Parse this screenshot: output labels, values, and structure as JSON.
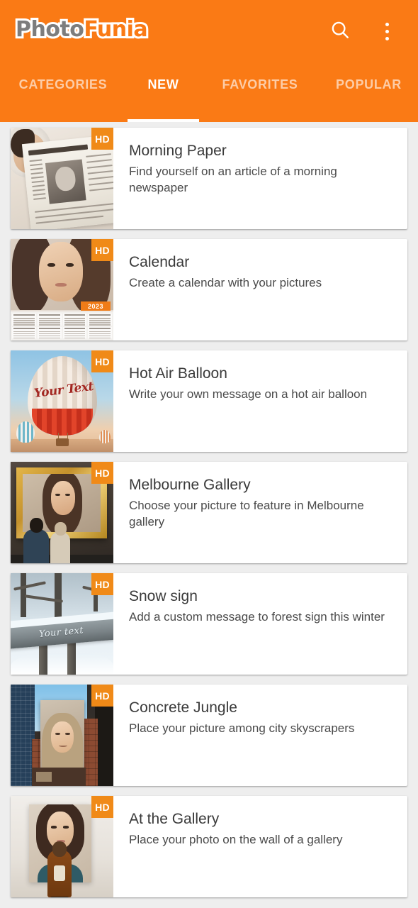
{
  "app": {
    "logo_prefix": "Photo",
    "logo_suffix": "Funia",
    "accent_color": "#FA7A15",
    "badge_color": "#F08A18"
  },
  "header": {
    "search_icon": "search-icon",
    "overflow_icon": "more-vertical-icon"
  },
  "tabs": [
    {
      "label": "CATEGORIES",
      "active": false
    },
    {
      "label": "NEW",
      "active": true
    },
    {
      "label": "FAVORITES",
      "active": false
    },
    {
      "label": "POPULAR",
      "active": false
    }
  ],
  "badge": {
    "hd_label": "HD"
  },
  "thumb_text": {
    "balloon": "Your Text",
    "snow": "Your text",
    "calendar_year": "2023"
  },
  "effects": [
    {
      "title": "Morning Paper",
      "description": "Find yourself on an article of a morning newspaper",
      "hd": "HD"
    },
    {
      "title": "Calendar",
      "description": "Create a calendar with your pictures",
      "hd": "HD"
    },
    {
      "title": "Hot Air Balloon",
      "description": "Write your own message on a hot air balloon",
      "hd": "HD"
    },
    {
      "title": "Melbourne Gallery",
      "description": "Choose your picture to feature in Melbourne gallery",
      "hd": "HD"
    },
    {
      "title": "Snow sign",
      "description": "Add a custom message to forest sign this winter",
      "hd": "HD"
    },
    {
      "title": "Concrete Jungle",
      "description": "Place your picture among city skyscrapers",
      "hd": "HD"
    },
    {
      "title": "At the Gallery",
      "description": "Place your photo on the wall of a gallery",
      "hd": "HD"
    }
  ]
}
